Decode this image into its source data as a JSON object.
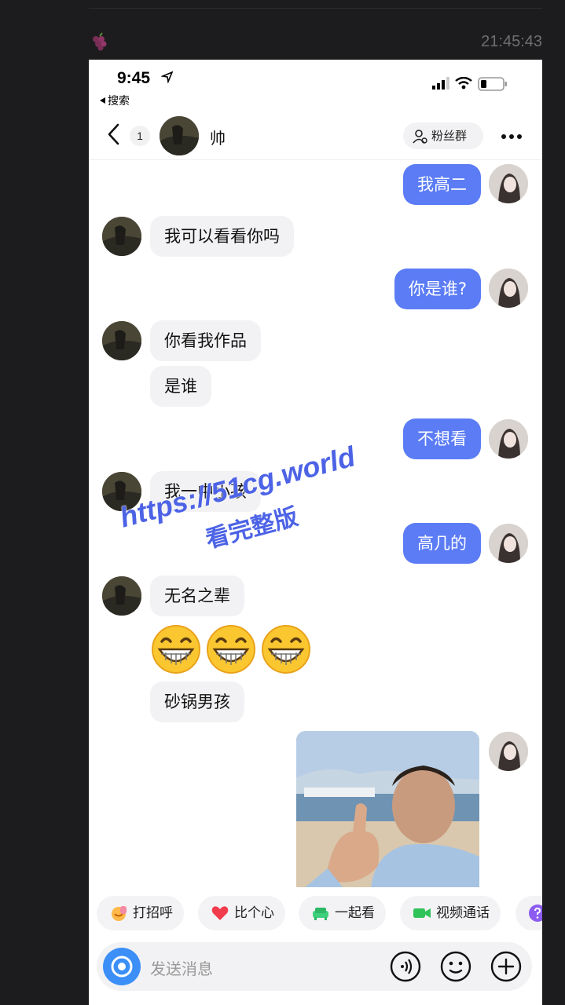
{
  "outer": {
    "timestamp": "21:45:43",
    "avatar_icon": "grapes-icon"
  },
  "status_bar": {
    "time": "9:45",
    "back_app": "搜索",
    "icons": [
      "location-arrow-icon",
      "signal-icon",
      "wifi-icon",
      "battery-icon"
    ]
  },
  "nav": {
    "unread_count": "1",
    "contact_name": "帅",
    "fans_group_label": "粉丝群",
    "more_icon": "more-icon"
  },
  "messages": [
    {
      "from": "me",
      "text": "我高二"
    },
    {
      "from": "him",
      "text": "我可以看看你吗"
    },
    {
      "from": "me",
      "text": "你是谁?"
    },
    {
      "from": "him",
      "text": "你看我作品"
    },
    {
      "from": "him",
      "text": "是谁"
    },
    {
      "from": "me",
      "text": "不想看"
    },
    {
      "from": "him",
      "text": "我一中小孩"
    },
    {
      "from": "me",
      "text": "高几的"
    },
    {
      "from": "him",
      "text": "无名之辈"
    },
    {
      "from": "him",
      "emoji": "grinning-face-icon",
      "count": 3
    },
    {
      "from": "him",
      "text": "砂锅男孩"
    },
    {
      "from": "me",
      "image": "thumbs-up-man-photo"
    }
  ],
  "watermark": {
    "line1": "https://51cg.world",
    "line2": "看完整版"
  },
  "quick_actions": [
    {
      "label": "打招呼",
      "icon": "wave-icon"
    },
    {
      "label": "比个心",
      "icon": "heart-icon"
    },
    {
      "label": "一起看",
      "icon": "sofa-icon"
    },
    {
      "label": "视频通话",
      "icon": "video-camera-icon"
    },
    {
      "label": "",
      "icon": "question-icon"
    }
  ],
  "input": {
    "placeholder": "发送消息",
    "icons": [
      "camera-icon",
      "voice-icon",
      "emoji-icon",
      "plus-icon"
    ]
  },
  "colors": {
    "outgoing_bubble": "#5b7cf5",
    "incoming_bubble": "#f2f2f4",
    "watermark": "#4d63e6",
    "background": "#1c1c1e"
  }
}
